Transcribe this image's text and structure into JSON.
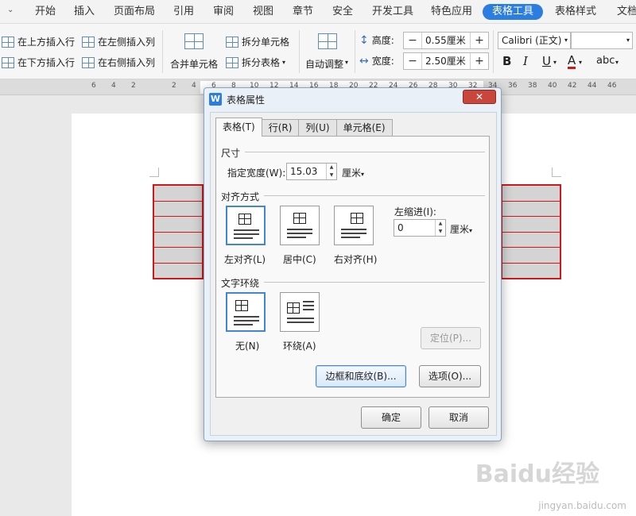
{
  "ribbon_tabs": [
    "开始",
    "插入",
    "页面布局",
    "引用",
    "审阅",
    "视图",
    "章节",
    "安全",
    "开发工具",
    "特色应用",
    "表格工具",
    "表格样式",
    "文档"
  ],
  "active_tab": "表格工具",
  "ribbon": {
    "insert_above": "在上方插入行",
    "insert_left": "在左侧插入列",
    "insert_below": "在下方插入行",
    "insert_right": "在右侧插入列",
    "merge_cells": "合并单元格",
    "split_cells": "拆分单元格",
    "split_table": "拆分表格",
    "auto_fit": "自动调整",
    "height_label": "高度:",
    "height_value": "0.55厘米",
    "width_label": "宽度:",
    "width_value": "2.50厘米",
    "font_name": "Calibri (正文)",
    "font_size": "",
    "bold": "B",
    "italic": "I",
    "underline": "U",
    "font_color": "A",
    "highlight": "abc"
  },
  "ruler_numbers": [
    "6",
    "4",
    "2",
    "2",
    "4",
    "6",
    "8",
    "10",
    "12",
    "14",
    "16",
    "18",
    "20",
    "22",
    "24",
    "26",
    "28",
    "30",
    "32",
    "34",
    "36",
    "38",
    "40",
    "42",
    "44",
    "46"
  ],
  "dialog": {
    "title": "表格属性",
    "close": "✕",
    "tabs": [
      "表格(T)",
      "行(R)",
      "列(U)",
      "单元格(E)"
    ],
    "active_tab": "表格(T)",
    "size_legend": "尺寸",
    "width_label": "指定宽度(W):",
    "width_value": "15.03",
    "width_unit": "厘米",
    "align_legend": "对齐方式",
    "align_left": "左对齐(L)",
    "align_center": "居中(C)",
    "align_right": "右对齐(H)",
    "indent_label": "左缩进(I):",
    "indent_value": "0",
    "indent_unit": "厘米",
    "wrap_legend": "文字环绕",
    "wrap_none": "无(N)",
    "wrap_around": "环绕(A)",
    "position_button": "定位(P)...",
    "borders_button": "边框和底纹(B)...",
    "options_button": "选项(O)...",
    "ok_button": "确定",
    "cancel_button": "取消"
  },
  "watermark": {
    "text": "Baidu经验",
    "url": "jingyan.baidu.com"
  },
  "colors": {
    "accent": "#2b7de0",
    "table_border": "#d01818"
  }
}
